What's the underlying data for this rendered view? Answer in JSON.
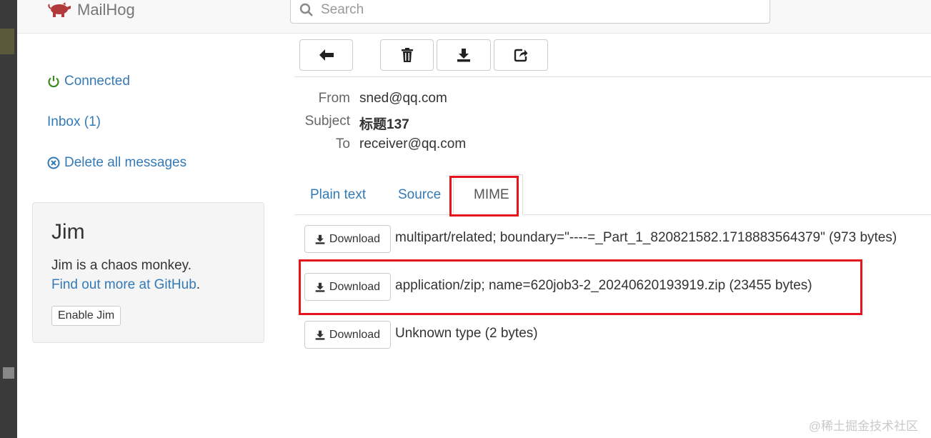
{
  "app": {
    "name": "MailHog"
  },
  "search": {
    "placeholder": "Search"
  },
  "sidebar": {
    "connected": "Connected",
    "inbox": "Inbox (1)",
    "delete_all": "Delete all messages"
  },
  "jim": {
    "title": "Jim",
    "description": "Jim is a chaos monkey.",
    "link_text": "Find out more at GitHub",
    "link_suffix": ".",
    "enable_button": "Enable Jim"
  },
  "toolbar": {
    "icons": [
      "arrow-left-icon",
      "trash-icon",
      "download-icon",
      "share-icon"
    ]
  },
  "message": {
    "from_label": "From",
    "from": "sned@qq.com",
    "subject_label": "Subject",
    "subject": "标题137",
    "to_label": "To",
    "to": "receiver@qq.com"
  },
  "tabs": {
    "plain": "Plain text",
    "source": "Source",
    "mime": "MIME",
    "active": "MIME"
  },
  "mime_parts": [
    {
      "button": "Download",
      "description": "multipart/related; boundary=\"----=_Part_1_820821582.1718883564379\" (973 bytes)"
    },
    {
      "button": "Download",
      "description": "application/zip; name=620job3-2_20240620193919.zip (23455 bytes)"
    },
    {
      "button": "Download",
      "description": "Unknown type (2 bytes)"
    }
  ],
  "colors": {
    "link": "#337ab7",
    "connected": "#3c8a1e",
    "highlight": "#e8141b"
  },
  "watermark": "@稀土掘金技术社区"
}
